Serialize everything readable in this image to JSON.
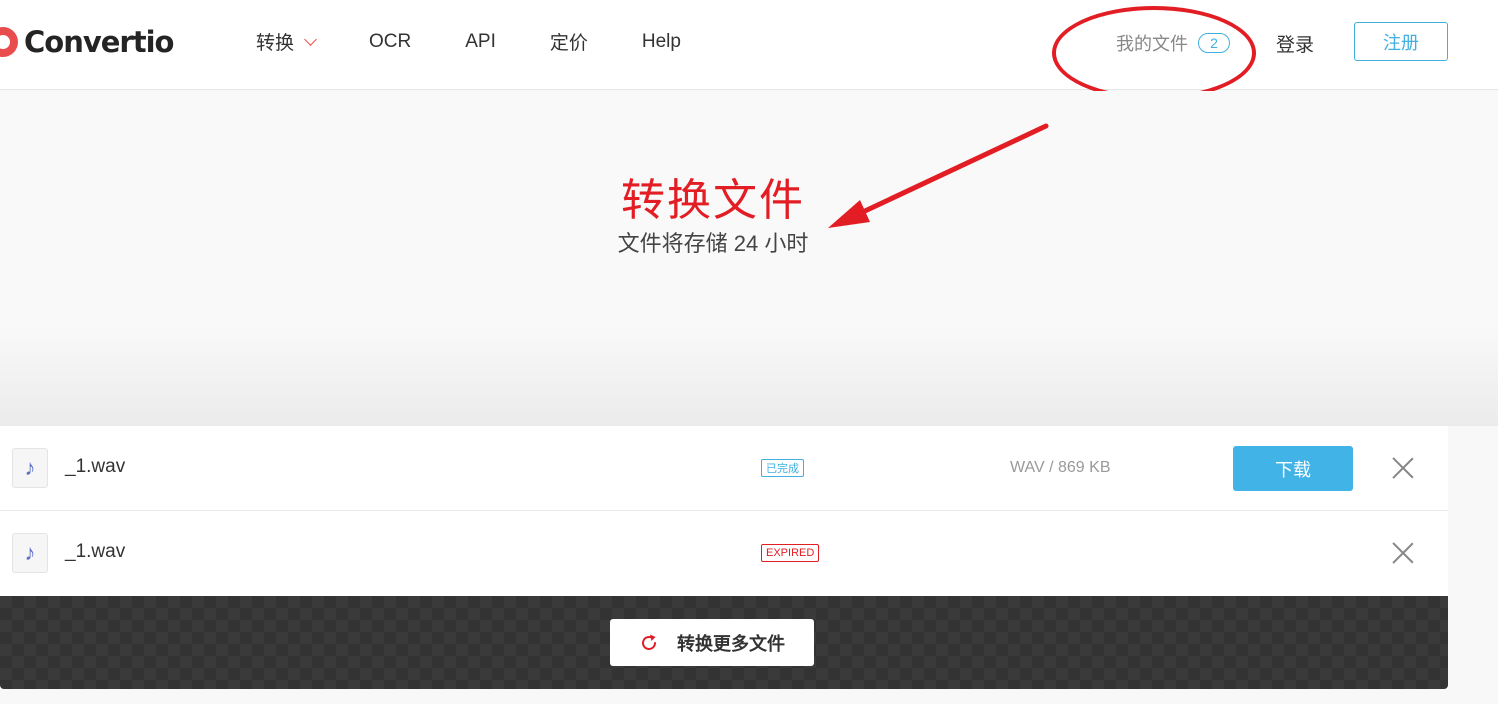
{
  "header": {
    "logo_text": "Convertio",
    "nav": [
      {
        "label": "转换",
        "has_dropdown": true
      },
      {
        "label": "OCR"
      },
      {
        "label": "API"
      },
      {
        "label": "定价"
      },
      {
        "label": "Help"
      }
    ],
    "my_files_label": "我的文件",
    "my_files_count": "2",
    "login_label": "登录",
    "signup_label": "注册"
  },
  "hero": {
    "title": "转换文件",
    "subtitle": "文件将存储 24 小时"
  },
  "files": [
    {
      "name": "_1.wav",
      "status": "已完成",
      "meta": "WAV / 869 KB",
      "action": "下载"
    },
    {
      "name": "_1.wav",
      "status": "EXPIRED"
    }
  ],
  "bottom": {
    "more_label": "转换更多文件"
  },
  "colors": {
    "accent_red": "#e21d24",
    "accent_blue": "#41b3e7",
    "text_dark": "#333333"
  }
}
